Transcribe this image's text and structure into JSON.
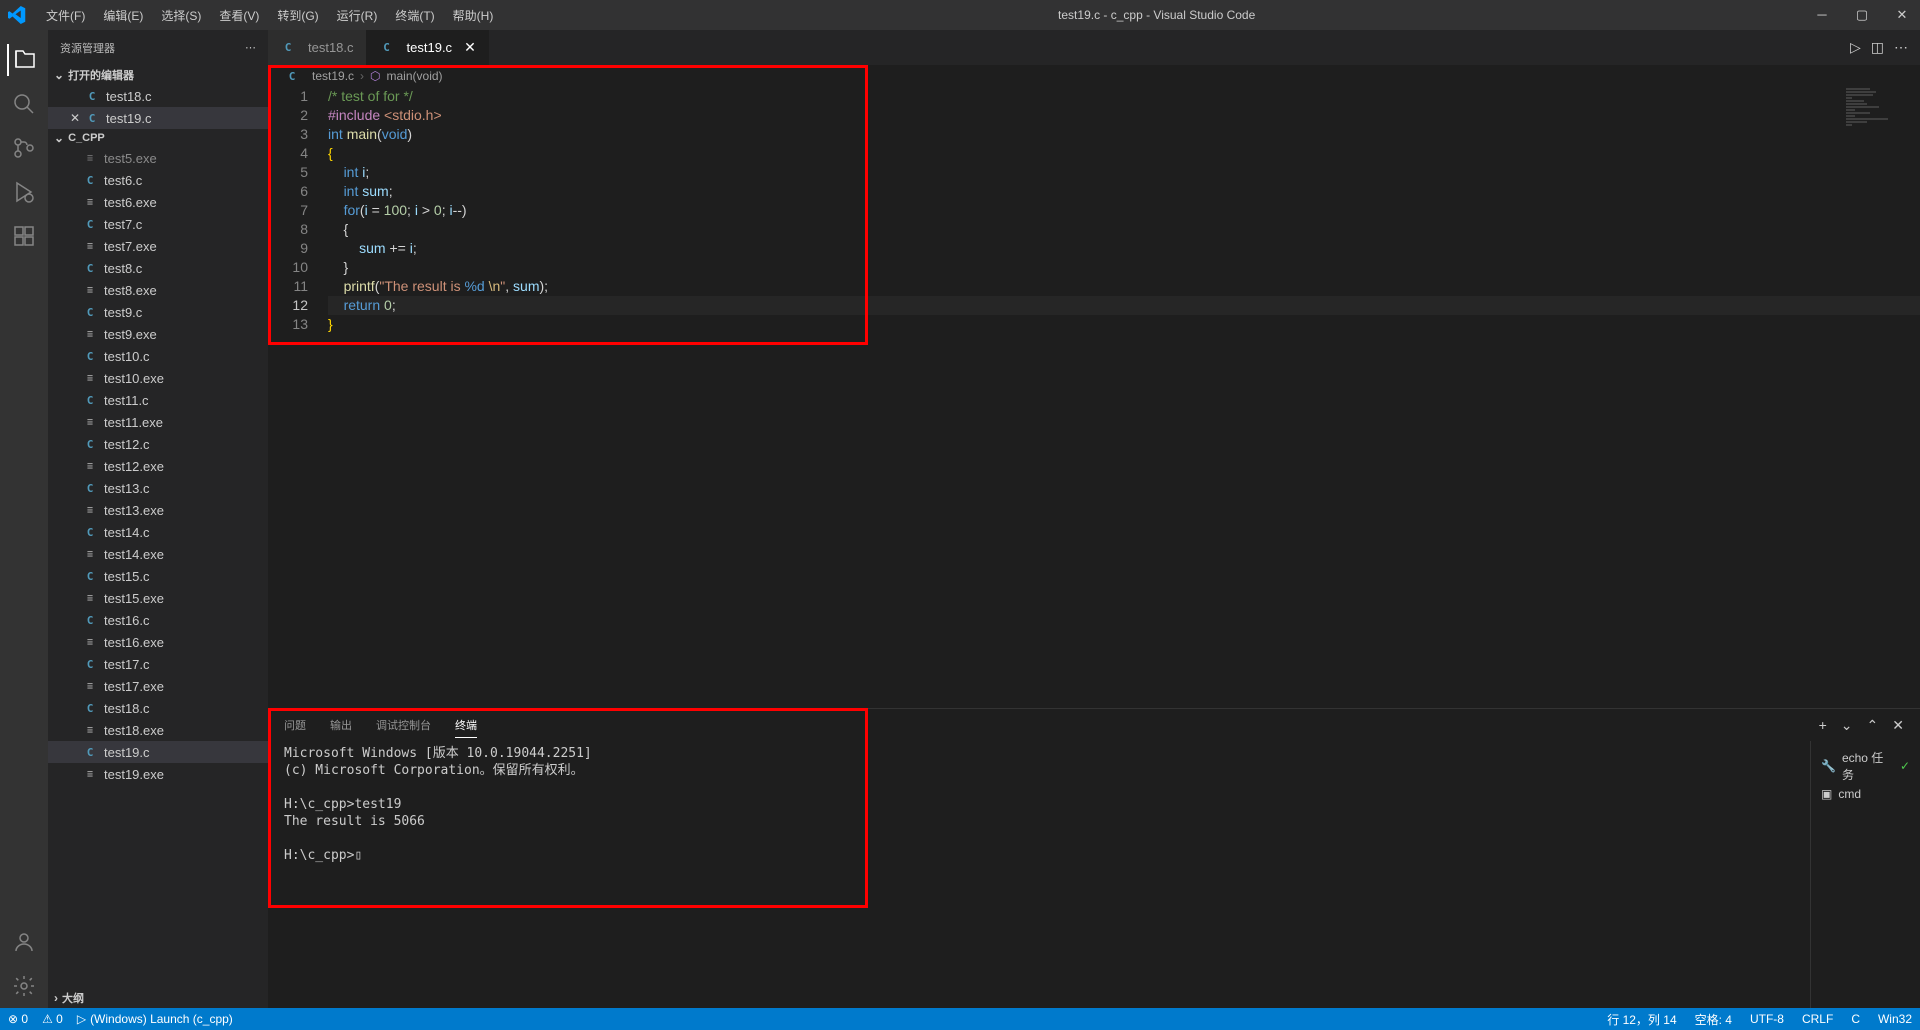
{
  "titlebar": {
    "menus": [
      "文件(F)",
      "编辑(E)",
      "选择(S)",
      "查看(V)",
      "转到(G)",
      "运行(R)",
      "终端(T)",
      "帮助(H)"
    ],
    "title": "test19.c - c_cpp - Visual Studio Code"
  },
  "sidebar": {
    "title": "资源管理器",
    "sections": {
      "open_editors": {
        "label": "打开的编辑器",
        "items": [
          {
            "name": "test18.c",
            "icon": "C"
          },
          {
            "name": "test19.c",
            "icon": "C",
            "hasClose": true,
            "selected": true
          }
        ]
      },
      "folder": {
        "label": "C_CPP",
        "items": [
          {
            "name": "test5.exe",
            "icon": "≡",
            "dim": true
          },
          {
            "name": "test6.c",
            "icon": "C"
          },
          {
            "name": "test6.exe",
            "icon": "≡"
          },
          {
            "name": "test7.c",
            "icon": "C"
          },
          {
            "name": "test7.exe",
            "icon": "≡"
          },
          {
            "name": "test8.c",
            "icon": "C"
          },
          {
            "name": "test8.exe",
            "icon": "≡"
          },
          {
            "name": "test9.c",
            "icon": "C"
          },
          {
            "name": "test9.exe",
            "icon": "≡"
          },
          {
            "name": "test10.c",
            "icon": "C"
          },
          {
            "name": "test10.exe",
            "icon": "≡"
          },
          {
            "name": "test11.c",
            "icon": "C"
          },
          {
            "name": "test11.exe",
            "icon": "≡"
          },
          {
            "name": "test12.c",
            "icon": "C"
          },
          {
            "name": "test12.exe",
            "icon": "≡"
          },
          {
            "name": "test13.c",
            "icon": "C"
          },
          {
            "name": "test13.exe",
            "icon": "≡"
          },
          {
            "name": "test14.c",
            "icon": "C"
          },
          {
            "name": "test14.exe",
            "icon": "≡"
          },
          {
            "name": "test15.c",
            "icon": "C"
          },
          {
            "name": "test15.exe",
            "icon": "≡"
          },
          {
            "name": "test16.c",
            "icon": "C"
          },
          {
            "name": "test16.exe",
            "icon": "≡"
          },
          {
            "name": "test17.c",
            "icon": "C"
          },
          {
            "name": "test17.exe",
            "icon": "≡"
          },
          {
            "name": "test18.c",
            "icon": "C"
          },
          {
            "name": "test18.exe",
            "icon": "≡"
          },
          {
            "name": "test19.c",
            "icon": "C",
            "selected": true
          },
          {
            "name": "test19.exe",
            "icon": "≡"
          }
        ]
      },
      "outline": {
        "label": "大纲"
      }
    }
  },
  "tabs": [
    {
      "name": "test18.c",
      "icon": "C"
    },
    {
      "name": "test19.c",
      "icon": "C",
      "active": true,
      "hasClose": true
    }
  ],
  "breadcrumb": {
    "file": "test19.c",
    "symbol": "main(void)"
  },
  "code": {
    "lines": [
      {
        "n": 1,
        "tokens": [
          [
            "/* test of for */",
            "comment"
          ]
        ]
      },
      {
        "n": 2,
        "tokens": [
          [
            "#include",
            "include"
          ],
          [
            " ",
            ""
          ],
          [
            "<stdio.h>",
            "string"
          ]
        ]
      },
      {
        "n": 3,
        "tokens": [
          [
            "int",
            "type"
          ],
          [
            " ",
            ""
          ],
          [
            "main",
            "func"
          ],
          [
            "(",
            ""
          ],
          [
            "void",
            "type"
          ],
          [
            ")",
            ""
          ]
        ]
      },
      {
        "n": 4,
        "tokens": [
          [
            "{",
            "bracket"
          ]
        ]
      },
      {
        "n": 5,
        "tokens": [
          [
            "    ",
            ""
          ],
          [
            "int",
            "type"
          ],
          [
            " ",
            ""
          ],
          [
            "i",
            "var"
          ],
          [
            ";",
            ""
          ]
        ]
      },
      {
        "n": 6,
        "tokens": [
          [
            "    ",
            ""
          ],
          [
            "int",
            "type"
          ],
          [
            " ",
            ""
          ],
          [
            "sum",
            "var"
          ],
          [
            ";",
            ""
          ]
        ]
      },
      {
        "n": 7,
        "tokens": [
          [
            "    ",
            ""
          ],
          [
            "for",
            "keyword"
          ],
          [
            "(",
            ""
          ],
          [
            "i",
            "var"
          ],
          [
            " = ",
            ""
          ],
          [
            "100",
            "number"
          ],
          [
            "; ",
            ""
          ],
          [
            "i",
            "var"
          ],
          [
            " > ",
            ""
          ],
          [
            "0",
            "number"
          ],
          [
            "; ",
            ""
          ],
          [
            "i",
            "var"
          ],
          [
            "--)",
            ""
          ]
        ]
      },
      {
        "n": 8,
        "tokens": [
          [
            "    {",
            ""
          ]
        ]
      },
      {
        "n": 9,
        "tokens": [
          [
            "        ",
            ""
          ],
          [
            "sum",
            "var"
          ],
          [
            " += ",
            ""
          ],
          [
            "i",
            "var"
          ],
          [
            ";",
            ""
          ]
        ]
      },
      {
        "n": 10,
        "tokens": [
          [
            "    }",
            ""
          ]
        ]
      },
      {
        "n": 11,
        "tokens": [
          [
            "    ",
            ""
          ],
          [
            "printf",
            "func"
          ],
          [
            "(",
            ""
          ],
          [
            "\"The result is ",
            "string"
          ],
          [
            "%d",
            "format"
          ],
          [
            " ",
            "string"
          ],
          [
            "\\n",
            "escape"
          ],
          [
            "\"",
            "string"
          ],
          [
            ", ",
            ""
          ],
          [
            "sum",
            "var"
          ],
          [
            ");",
            ""
          ]
        ]
      },
      {
        "n": 12,
        "active": true,
        "tokens": [
          [
            "    ",
            ""
          ],
          [
            "return",
            "keyword"
          ],
          [
            " ",
            ""
          ],
          [
            "0",
            "number"
          ],
          [
            ";",
            ""
          ]
        ]
      },
      {
        "n": 13,
        "tokens": [
          [
            "}",
            "bracket"
          ]
        ]
      }
    ]
  },
  "panel": {
    "tabs": [
      "问题",
      "输出",
      "调试控制台",
      "终端"
    ],
    "activeTab": 3,
    "terminal": "Microsoft Windows [版本 10.0.19044.2251]\n(c) Microsoft Corporation。保留所有权利。\n\nH:\\c_cpp>test19\nThe result is 5066\n\nH:\\c_cpp>▯",
    "sideItems": [
      {
        "icon": "🔧",
        "label": "echo 任务",
        "check": "✓"
      },
      {
        "icon": "▣",
        "label": "cmd"
      }
    ]
  },
  "statusbar": {
    "left": {
      "errors": "⊗ 0",
      "warnings": "⚠ 0",
      "launch": "(Windows) Launch (c_cpp)"
    },
    "right": {
      "position": "行 12，列 14",
      "spaces": "空格: 4",
      "encoding": "UTF-8",
      "eol": "CRLF",
      "lang": "C",
      "win32": "Win32"
    }
  }
}
